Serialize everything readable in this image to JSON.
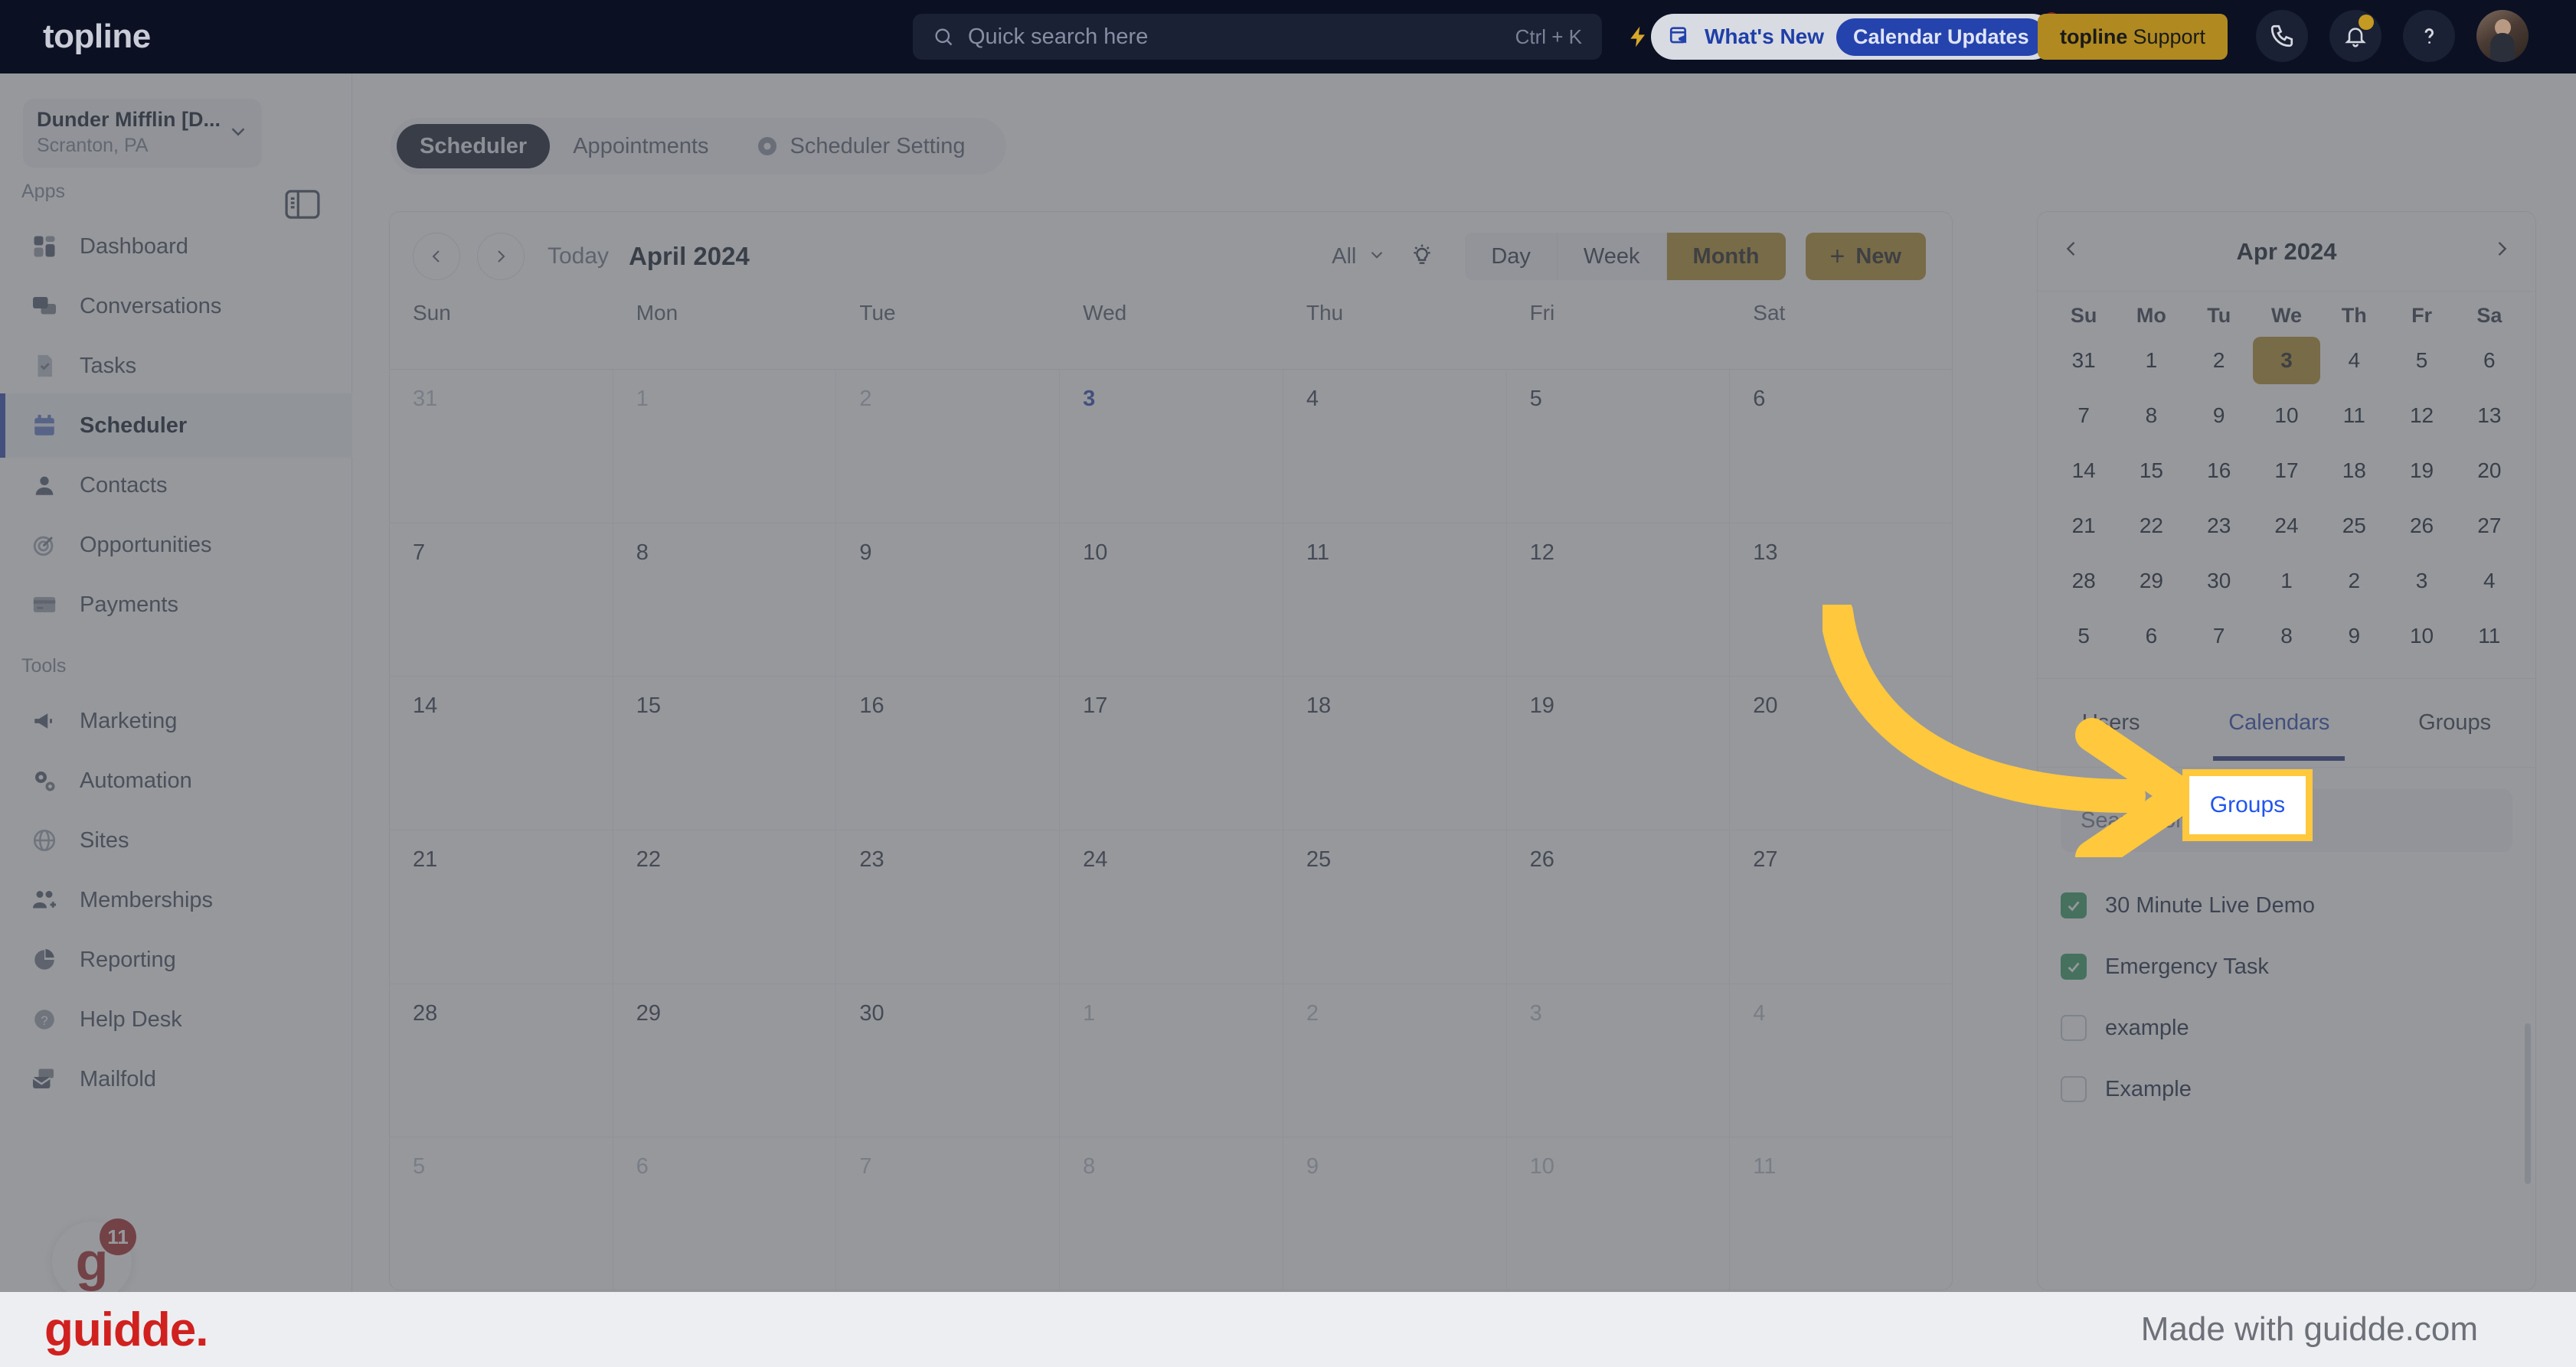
{
  "topbar": {
    "brand": "topline",
    "search": {
      "placeholder": "Quick search here",
      "shortcut": "Ctrl + K",
      "icon": "search-icon"
    },
    "bolt_icon": "lightning-bolt-icon",
    "whats_new": {
      "label": "What's New",
      "pill": "Calendar Updates",
      "icon": "announcement-calendar-icon"
    },
    "support_button": {
      "brand": "topline",
      "label": "Support"
    },
    "icons": {
      "phone": "phone-icon",
      "bell": "bell-icon",
      "help": "question-mark-icon",
      "avatar": "user-avatar"
    }
  },
  "sidebar": {
    "org": {
      "name": "Dunder Mifflin [D...",
      "location": "Scranton, PA",
      "chevron": "chevron-down-icon"
    },
    "panel_toggle_icon": "collapse-panel-icon",
    "sections": [
      {
        "label": "Apps"
      },
      {
        "label": "Tools"
      }
    ],
    "apps": [
      {
        "label": "Dashboard",
        "icon": "dashboard-icon"
      },
      {
        "label": "Conversations",
        "icon": "chat-bubbles-icon"
      },
      {
        "label": "Tasks",
        "icon": "task-check-icon"
      },
      {
        "label": "Scheduler",
        "icon": "calendar-icon",
        "active": true
      },
      {
        "label": "Contacts",
        "icon": "person-icon"
      },
      {
        "label": "Opportunities",
        "icon": "target-icon"
      },
      {
        "label": "Payments",
        "icon": "credit-card-icon"
      }
    ],
    "tools": [
      {
        "label": "Marketing",
        "icon": "megaphone-icon"
      },
      {
        "label": "Automation",
        "icon": "gears-icon"
      },
      {
        "label": "Sites",
        "icon": "globe-icon"
      },
      {
        "label": "Memberships",
        "icon": "people-add-icon"
      },
      {
        "label": "Reporting",
        "icon": "pie-chart-icon"
      },
      {
        "label": "Help Desk",
        "icon": "help-circle-icon"
      },
      {
        "label": "Mailfold",
        "icon": "mail-stack-icon"
      }
    ],
    "concierge": {
      "logo": "g",
      "count": "11"
    }
  },
  "main": {
    "tabs": [
      {
        "label": "Scheduler",
        "active": true
      },
      {
        "label": "Appointments",
        "active": false
      },
      {
        "label": "Scheduler Setting",
        "active": false,
        "icon": "gear-icon"
      }
    ],
    "toolbar": {
      "prev_icon": "chevron-left-icon",
      "next_icon": "chevron-right-icon",
      "today_label": "Today",
      "title": "April 2024",
      "filter_label": "All",
      "filter_chevron": "chevron-down-icon",
      "bulb_icon": "lightbulb-icon",
      "views": [
        {
          "label": "Day",
          "active": false
        },
        {
          "label": "Week",
          "active": false
        },
        {
          "label": "Month",
          "active": true
        }
      ],
      "new_button": {
        "plus": "+",
        "label": "New"
      }
    },
    "day_headers": [
      "Sun",
      "Mon",
      "Tue",
      "Wed",
      "Thu",
      "Fri",
      "Sat"
    ],
    "grid_weeks": [
      [
        {
          "d": "31",
          "state": "muted"
        },
        {
          "d": "1",
          "state": "muted"
        },
        {
          "d": "2",
          "state": "muted"
        },
        {
          "d": "3",
          "state": "today"
        },
        {
          "d": "4",
          "state": ""
        },
        {
          "d": "5",
          "state": ""
        },
        {
          "d": "6",
          "state": ""
        }
      ],
      [
        {
          "d": "7",
          "state": ""
        },
        {
          "d": "8",
          "state": ""
        },
        {
          "d": "9",
          "state": ""
        },
        {
          "d": "10",
          "state": ""
        },
        {
          "d": "11",
          "state": ""
        },
        {
          "d": "12",
          "state": ""
        },
        {
          "d": "13",
          "state": ""
        }
      ],
      [
        {
          "d": "14",
          "state": ""
        },
        {
          "d": "15",
          "state": ""
        },
        {
          "d": "16",
          "state": ""
        },
        {
          "d": "17",
          "state": ""
        },
        {
          "d": "18",
          "state": ""
        },
        {
          "d": "19",
          "state": ""
        },
        {
          "d": "20",
          "state": ""
        }
      ],
      [
        {
          "d": "21",
          "state": ""
        },
        {
          "d": "22",
          "state": ""
        },
        {
          "d": "23",
          "state": ""
        },
        {
          "d": "24",
          "state": ""
        },
        {
          "d": "25",
          "state": ""
        },
        {
          "d": "26",
          "state": ""
        },
        {
          "d": "27",
          "state": ""
        }
      ],
      [
        {
          "d": "28",
          "state": ""
        },
        {
          "d": "29",
          "state": ""
        },
        {
          "d": "30",
          "state": ""
        },
        {
          "d": "1",
          "state": "muted"
        },
        {
          "d": "2",
          "state": "muted"
        },
        {
          "d": "3",
          "state": "muted"
        },
        {
          "d": "4",
          "state": "muted"
        }
      ],
      [
        {
          "d": "5",
          "state": "muted"
        },
        {
          "d": "6",
          "state": "muted"
        },
        {
          "d": "7",
          "state": "muted"
        },
        {
          "d": "8",
          "state": "muted"
        },
        {
          "d": "9",
          "state": "muted"
        },
        {
          "d": "10",
          "state": "muted"
        },
        {
          "d": "11",
          "state": "muted"
        }
      ]
    ]
  },
  "right_panel": {
    "mini_calendar": {
      "prev_icon": "chevron-left-icon",
      "title": "Apr 2024",
      "next_icon": "chevron-right-icon",
      "day_headers": [
        "Su",
        "Mo",
        "Tu",
        "We",
        "Th",
        "Fr",
        "Sa"
      ],
      "weeks": [
        [
          {
            "d": "31"
          },
          {
            "d": "1"
          },
          {
            "d": "2"
          },
          {
            "d": "3",
            "sel": true
          },
          {
            "d": "4"
          },
          {
            "d": "5"
          },
          {
            "d": "6"
          }
        ],
        [
          {
            "d": "7"
          },
          {
            "d": "8"
          },
          {
            "d": "9"
          },
          {
            "d": "10"
          },
          {
            "d": "11"
          },
          {
            "d": "12"
          },
          {
            "d": "13"
          }
        ],
        [
          {
            "d": "14"
          },
          {
            "d": "15"
          },
          {
            "d": "16"
          },
          {
            "d": "17"
          },
          {
            "d": "18"
          },
          {
            "d": "19"
          },
          {
            "d": "20"
          }
        ],
        [
          {
            "d": "21"
          },
          {
            "d": "22"
          },
          {
            "d": "23"
          },
          {
            "d": "24"
          },
          {
            "d": "25"
          },
          {
            "d": "26"
          },
          {
            "d": "27"
          }
        ],
        [
          {
            "d": "28"
          },
          {
            "d": "29"
          },
          {
            "d": "30"
          },
          {
            "d": "1"
          },
          {
            "d": "2"
          },
          {
            "d": "3"
          },
          {
            "d": "4"
          }
        ],
        [
          {
            "d": "5"
          },
          {
            "d": "6"
          },
          {
            "d": "7"
          },
          {
            "d": "8"
          },
          {
            "d": "9"
          },
          {
            "d": "10"
          },
          {
            "d": "11"
          }
        ]
      ]
    },
    "subtabs": [
      {
        "label": "Users",
        "active": false
      },
      {
        "label": "Calendars",
        "active": true
      },
      {
        "label": "Groups",
        "active": false
      }
    ],
    "search": {
      "placeholder": "Search for Calendar"
    },
    "calendars": [
      {
        "name": "30 Minute Live Demo",
        "checked": true
      },
      {
        "name": "Emergency Task",
        "checked": true
      },
      {
        "name": "example",
        "checked": false
      },
      {
        "name": "Example",
        "checked": false
      }
    ]
  },
  "callout": {
    "label": "Groups",
    "border_color": "#ffc83d",
    "text_color": "#2255ee",
    "arrow_color": "#ffc83d"
  },
  "footer": {
    "logo": "guidde.",
    "made_with": "Made with guidde.com"
  },
  "colors": {
    "topbar_bg": "#0b1023",
    "accent_gold": "#b08a20",
    "accent_blue": "#2543ad",
    "check_green": "#2e9960",
    "highlight_yellow": "#ffc83d"
  }
}
